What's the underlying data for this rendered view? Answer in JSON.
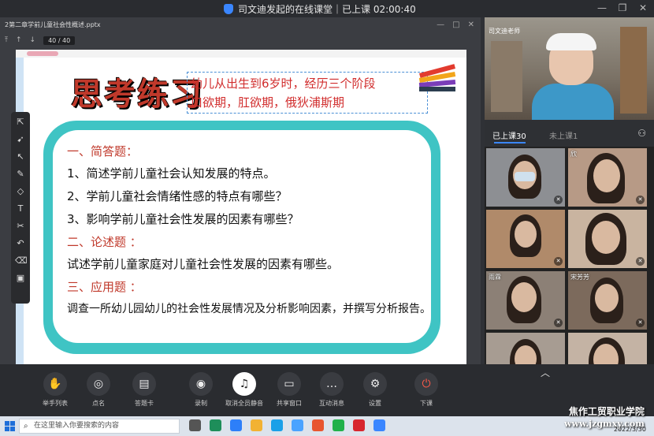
{
  "window": {
    "title": "司文迪发起的在线课堂｜已上课 02:00:40",
    "controls": [
      "minimize-icon",
      "restore-icon",
      "close-icon"
    ]
  },
  "viewer": {
    "filename": "2第二章学前儿童社会性概述.pptx",
    "page_current": "40",
    "page_total": "/ 40"
  },
  "slide": {
    "title": "思考练习",
    "note_line1": "幼儿从出生到6岁时，经历三个阶段",
    "note_line2": "口欲期，肛欲期，俄狄浦斯期",
    "sections": [
      {
        "heading": "一、简答题：",
        "items": [
          "1、简述学前儿童社会认知发展的特点。",
          "2、学前儿童社会情绪性感的特点有哪些？",
          "3、影响学前儿童社会性发展的因素有哪些？"
        ]
      },
      {
        "heading": "二、论述题 ：",
        "items": [
          "试述学前儿童家庭对儿童社会性发展的因素有哪些。"
        ]
      },
      {
        "heading": "三、应用题 ：",
        "items": [
          "调查一所幼儿园幼儿的社会性发展情况及分析影响因素，并撰写分析报告。"
        ]
      }
    ]
  },
  "teacher": {
    "name": "司文迪老师"
  },
  "attendance": {
    "present_tab": "已上课30",
    "absent_tab": "未上课1"
  },
  "students": [
    {
      "label": ""
    },
    {
      "label": "欣"
    },
    {
      "label": ""
    },
    {
      "label": ""
    },
    {
      "label": "雨霖"
    },
    {
      "label": "宋芳芳"
    },
    {
      "label": ""
    },
    {
      "label": ""
    }
  ],
  "toolbar": {
    "buttons": [
      {
        "label": "举手列表",
        "icon": "hand-icon"
      },
      {
        "label": "点名",
        "icon": "roll-call-icon"
      },
      {
        "label": "答题卡",
        "icon": "answer-card-icon"
      },
      {
        "label": "录制",
        "icon": "record-icon"
      },
      {
        "label": "取消全员静音",
        "icon": "unmute-all-icon"
      },
      {
        "label": "共享窗口",
        "icon": "share-window-icon"
      },
      {
        "label": "互动消息",
        "icon": "chat-icon"
      },
      {
        "label": "设置",
        "icon": "settings-icon"
      },
      {
        "label": "下课",
        "icon": "end-class-icon"
      }
    ]
  },
  "taskbar": {
    "search_placeholder": "在这里输入你要搜索的内容",
    "date": "2022/3/30"
  },
  "watermark": {
    "school": "焦作工贸职业学院",
    "url": "www.jzgmxy.com"
  },
  "colors": {
    "accent": "#3a86ff",
    "slide_red": "#c0392b",
    "panel_teal": "#3fc4c4",
    "end_red": "#ff5a4a"
  }
}
